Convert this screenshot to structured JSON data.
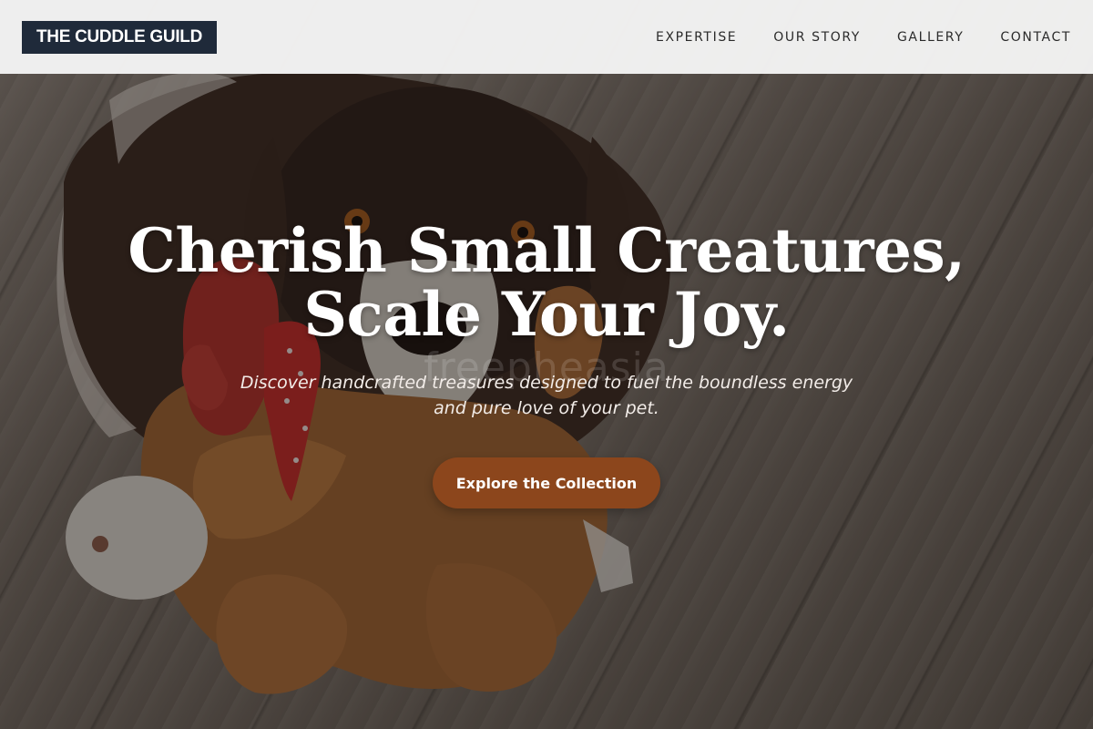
{
  "brand": {
    "logo_text": "THE CUDDLE GUILD"
  },
  "nav": {
    "items": [
      {
        "label": "EXPERTISE"
      },
      {
        "label": "OUR STORY"
      },
      {
        "label": "GALLERY"
      },
      {
        "label": "CONTACT"
      }
    ]
  },
  "hero": {
    "headline_line1": "Cherish Small Creatures,",
    "headline_line2": "Scale Your Joy.",
    "subtitle_line1": "Discover handcrafted treasures designed to fuel the boundless energy",
    "subtitle_line2": "and pure love of your pet.",
    "cta_label": "Explore the Collection",
    "watermark_text": "freepheasia"
  },
  "colors": {
    "logo_bg": "#1f2a3a",
    "cta_bg": "#8c461c",
    "header_bg": "#f5f5f5"
  }
}
